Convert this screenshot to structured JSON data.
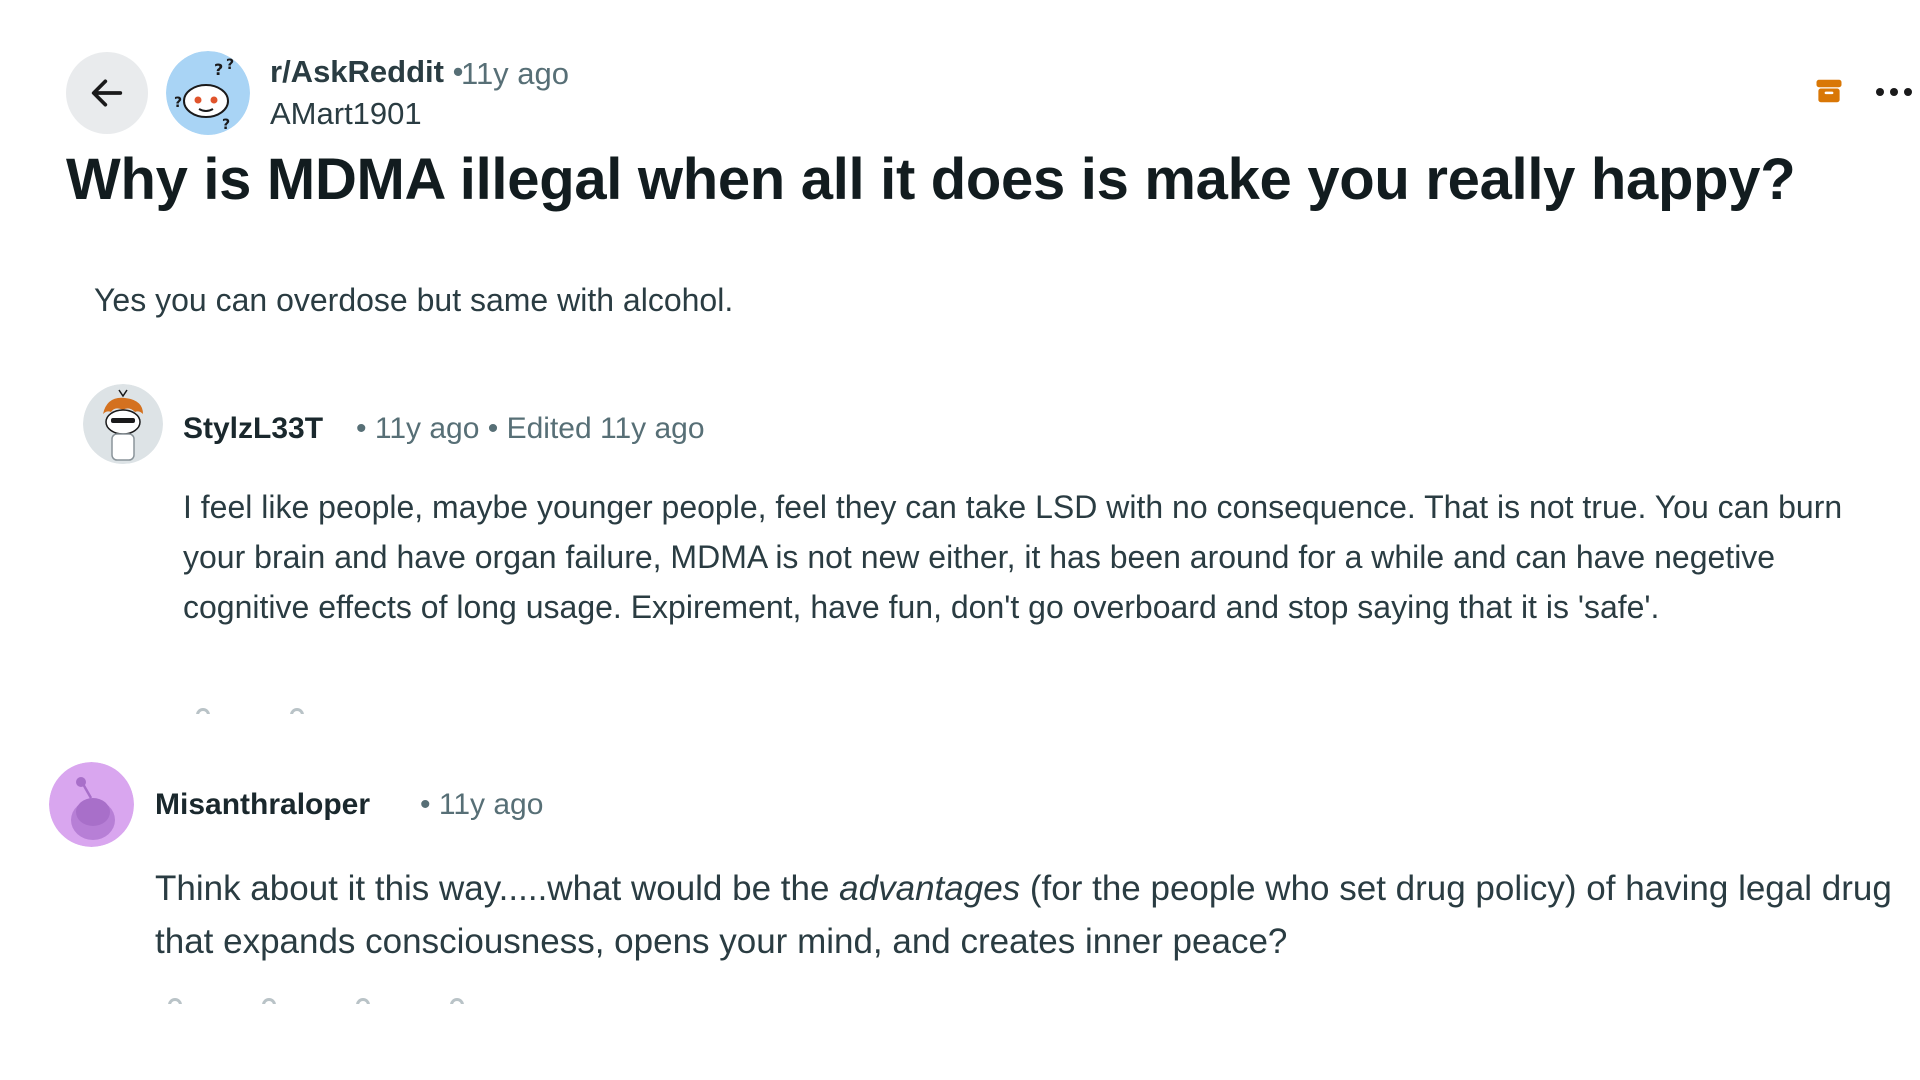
{
  "post": {
    "subreddit": "r/AskReddit",
    "separator": "•",
    "age": "11y ago",
    "author": "AMart1901",
    "title": "Why is MDMA illegal when all it does is make you really happy?",
    "body": "Yes you can overdose but same with alcohol."
  },
  "toolbar": {
    "back_icon": "arrow-left-icon",
    "archive_icon": "archive-icon",
    "more_icon": "more-horizontal-icon"
  },
  "comments": [
    {
      "author": "StylzL33T",
      "separator": "•",
      "age": "11y ago",
      "separator2": "•",
      "edited": "Edited 11y ago",
      "text": "I feel like people, maybe younger people, feel they can take LSD with no consequence. That is not true. You can burn your brain and have organ failure, MDMA is not new either, it has been around for a while and can have negetive cognitive effects of long usage. Expirement, have fun, don't go overboard and stop saying that it is 'safe'."
    },
    {
      "author": "Misanthraloper",
      "separator": "•",
      "age": "11y ago",
      "text_before": "Think about it this way.....what would be the ",
      "text_emphasis": "advantages",
      "text_after": " (for the people who set drug policy) of having legal drug that expands consciousness, opens your mind, and creates inner peace?"
    }
  ],
  "colors": {
    "accent_archive": "#d97706",
    "meta_text": "#576f76",
    "avatar_purple": "#d9a6ef"
  }
}
